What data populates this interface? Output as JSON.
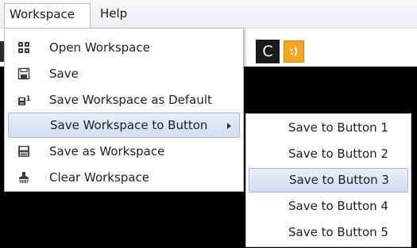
{
  "menubar": {
    "items": [
      {
        "label": "Workspace"
      },
      {
        "label": "Help"
      }
    ]
  },
  "toolbar": {
    "c_button_label": "C",
    "smiley_icon": "smiley-icon"
  },
  "workspace_menu": {
    "items": [
      {
        "label": "Open Workspace",
        "icon": "open-workspace-icon"
      },
      {
        "label": "Save",
        "icon": "save-icon"
      },
      {
        "label": "Save Workspace as Default",
        "icon": "save-default-icon"
      },
      {
        "label": "Save Workspace to Button",
        "icon": "",
        "has_submenu": true,
        "highlighted": true
      },
      {
        "label": "Save as Workspace",
        "icon": "save-as-icon"
      },
      {
        "label": "Clear Workspace",
        "icon": "clear-workspace-icon"
      }
    ]
  },
  "submenu": {
    "items": [
      {
        "label": "Save to Button 1"
      },
      {
        "label": "Save to Button 2"
      },
      {
        "label": "Save to Button 3",
        "highlighted": true
      },
      {
        "label": "Save to Button 4"
      },
      {
        "label": "Save to Button 5"
      }
    ]
  },
  "colors": {
    "highlight": "#d3ddf1",
    "highlight_border": "#a9b8d8",
    "canvas": "#000000",
    "smiley_button": "#f5a623"
  }
}
